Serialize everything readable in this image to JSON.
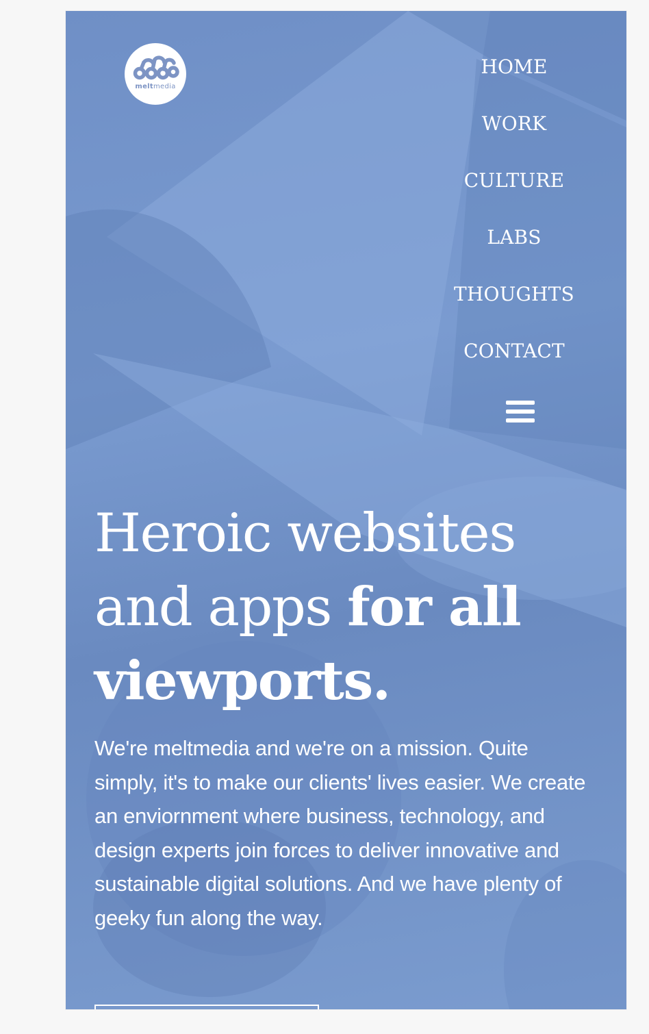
{
  "brand": {
    "logo_text_bold": "melt",
    "logo_text_light": "media"
  },
  "nav": {
    "items": [
      {
        "label": "HOME"
      },
      {
        "label": "WORK"
      },
      {
        "label": "CULTURE"
      },
      {
        "label": "LABS"
      },
      {
        "label": "THOUGHTS"
      },
      {
        "label": "CONTACT"
      }
    ],
    "menu_icon": "hamburger-menu-icon"
  },
  "hero": {
    "title_light": "Heroic websites and apps ",
    "title_bold": "for all viewports.",
    "body": "We're meltmedia and we're on a mission. Quite simply, it's to make our clients' lives easier. We create an enviornment where business, technology, and design experts join forces to deliver innovative and sustainable digital solutions. And we have plenty of geeky fun along the way."
  },
  "colors": {
    "overlay_blue": "#7a9bd0",
    "text": "#ffffff",
    "logo_text": "#7d94c4"
  }
}
